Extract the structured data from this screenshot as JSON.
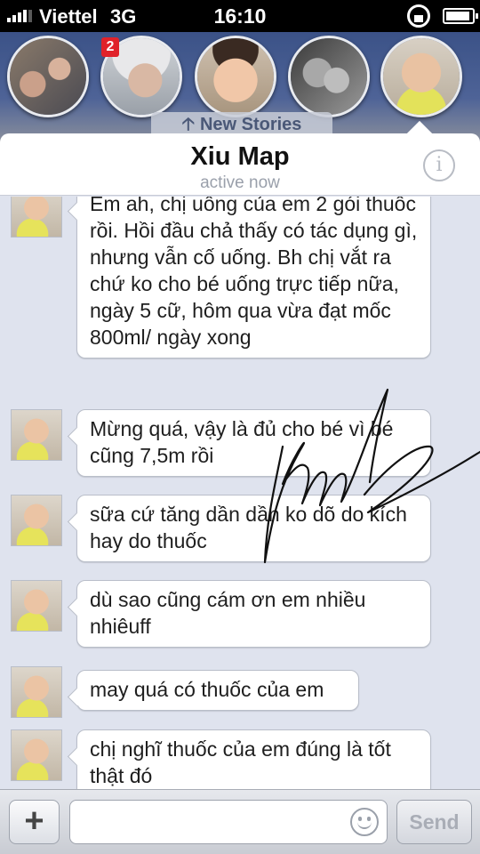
{
  "status_bar": {
    "carrier": "Viettel",
    "network": "3G",
    "time": "16:10"
  },
  "stories": {
    "badge_count": "2",
    "new_stories_label": "New Stories"
  },
  "header": {
    "title": "Xiu Map",
    "subtitle": "active now"
  },
  "messages": [
    {
      "text": "Em ah, chị uống của em 2 gói thuốc rồi. Hồi đầu chả thấy có tác dụng gì, nhưng vẫn cố uống. Bh chị vắt ra chứ ko cho bé uống trực tiếp nữa, ngày 5 cữ, hôm qua vừa đạt mốc 800ml/ ngày xong"
    },
    {
      "text": "Mừng quá, vậy là đủ cho bé vì bé cũng 7,5m rồi"
    },
    {
      "text": "sữa cứ tăng dần dần ko dõ do kích hay do thuốc"
    },
    {
      "text": "dù sao cũng cám ơn em nhiều nhiêuff"
    },
    {
      "text": "may quá có thuốc của em"
    },
    {
      "text": "chị nghĩ thuốc của em đúng là tốt thật đó"
    }
  ],
  "composer": {
    "placeholder": "",
    "send_label": "Send"
  },
  "icons": {
    "info": "info-icon",
    "plus": "plus-icon",
    "emoji": "smiley-icon",
    "lock": "rotation-lock-icon",
    "battery": "battery-icon",
    "signal": "signal-icon"
  },
  "colors": {
    "nav_blue": "#3b5287",
    "thread_bg": "#dfe3ee",
    "badge_red": "#e0222a"
  }
}
